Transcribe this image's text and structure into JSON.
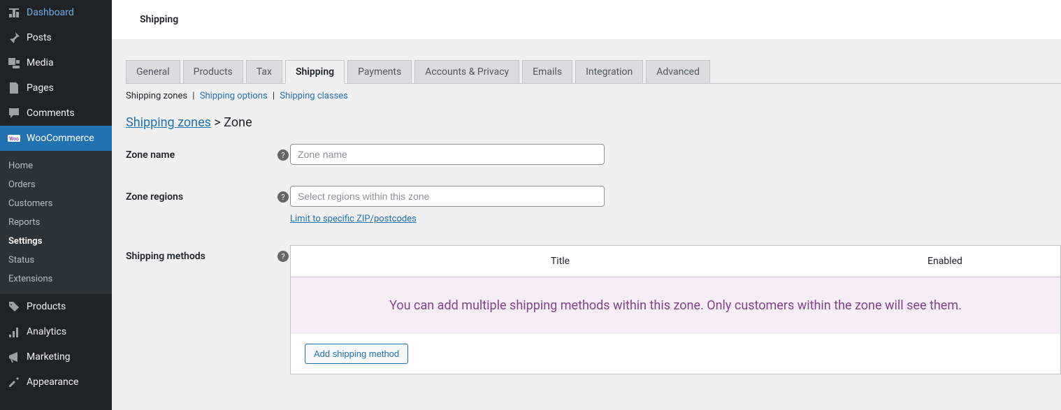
{
  "sidebar": {
    "items": [
      {
        "label": "Dashboard",
        "icon": "dashboard"
      },
      {
        "label": "Posts",
        "icon": "pin"
      },
      {
        "label": "Media",
        "icon": "media"
      },
      {
        "label": "Pages",
        "icon": "pages"
      },
      {
        "label": "Comments",
        "icon": "comments"
      },
      {
        "label": "WooCommerce",
        "icon": "woo",
        "active": true
      },
      {
        "label": "Products",
        "icon": "products"
      },
      {
        "label": "Analytics",
        "icon": "analytics"
      },
      {
        "label": "Marketing",
        "icon": "marketing"
      },
      {
        "label": "Appearance",
        "icon": "appearance"
      }
    ],
    "submenu": [
      {
        "label": "Home"
      },
      {
        "label": "Orders"
      },
      {
        "label": "Customers"
      },
      {
        "label": "Reports"
      },
      {
        "label": "Settings",
        "active": true
      },
      {
        "label": "Status"
      },
      {
        "label": "Extensions"
      }
    ]
  },
  "header": {
    "title": "Shipping"
  },
  "tabs": [
    {
      "label": "General"
    },
    {
      "label": "Products"
    },
    {
      "label": "Tax"
    },
    {
      "label": "Shipping",
      "active": true
    },
    {
      "label": "Payments"
    },
    {
      "label": "Accounts & Privacy"
    },
    {
      "label": "Emails"
    },
    {
      "label": "Integration"
    },
    {
      "label": "Advanced"
    }
  ],
  "sublinks": {
    "current": "Shipping zones",
    "links": [
      "Shipping options",
      "Shipping classes"
    ]
  },
  "breadcrumb": {
    "link": "Shipping zones",
    "sep": ">",
    "current": "Zone"
  },
  "form": {
    "zone_name": {
      "label": "Zone name",
      "placeholder": "Zone name"
    },
    "zone_regions": {
      "label": "Zone regions",
      "placeholder": "Select regions within this zone",
      "limit_link": "Limit to specific ZIP/postcodes"
    },
    "methods": {
      "label": "Shipping methods",
      "th_title": "Title",
      "th_enabled": "Enabled",
      "empty_msg": "You can add multiple shipping methods within this zone. Only customers within the zone will see them.",
      "add_btn": "Add shipping method"
    }
  },
  "help_glyph": "?"
}
